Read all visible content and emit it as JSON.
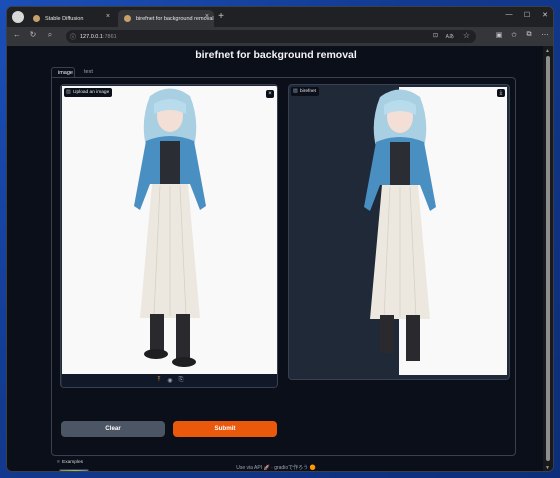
{
  "browser": {
    "tabs": [
      {
        "label": "Stable Diffusion",
        "close": "×"
      },
      {
        "label": "birefnet for background removal",
        "close": "×"
      }
    ],
    "new_tab": "+",
    "window_controls": {
      "minimize": "—",
      "maximize": "☐",
      "close": "✕"
    },
    "address": {
      "host": "127.0.0.1",
      "port": ":7861",
      "zoom": "Aあ"
    }
  },
  "app": {
    "title": "birefnet for background removal",
    "tabs": [
      "image",
      "text"
    ],
    "selected_tab": "image",
    "input": {
      "label": "Upload an image",
      "clear_icon": "×"
    },
    "output": {
      "label": "birefnet",
      "download_icon": "⤓"
    },
    "buttons": {
      "clear": "Clear",
      "submit": "Submit"
    },
    "examples": {
      "label": "Examples"
    },
    "footer": {
      "api": "Use via API",
      "api_icon": "🚀",
      "sep": "·",
      "built": "gradioで作ろう",
      "built_icon": "🟠"
    }
  },
  "colors": {
    "accent": "#ea580c",
    "secondary_button": "#4b5563",
    "page_bg": "#0b0f19",
    "panel_border": "#374151"
  }
}
